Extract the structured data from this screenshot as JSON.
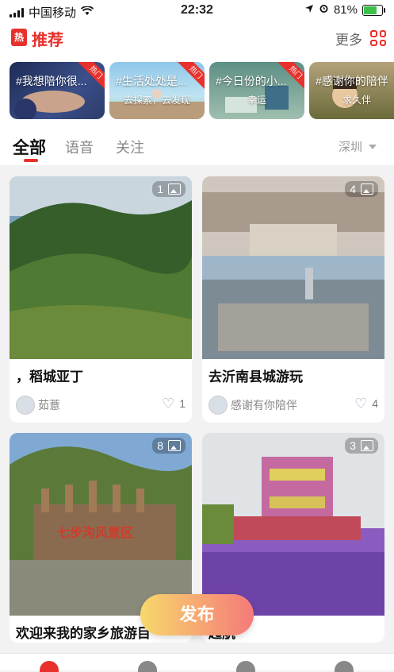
{
  "status_bar": {
    "carrier": "中国移动",
    "time": "22:32",
    "battery": "81%",
    "battery_level": 0.81
  },
  "header": {
    "hot_badge": "热",
    "title": "推荐",
    "more_label": "更多"
  },
  "topics": [
    {
      "label": "#我想陪你很...",
      "sub": "",
      "badge": "热门"
    },
    {
      "label": "#生活处处是...",
      "sub": "去探索，去发现",
      "badge": "热门"
    },
    {
      "label": "#今日份的小...",
      "sub": "幸运",
      "badge": "热门"
    },
    {
      "label": "#感谢你的陪伴",
      "sub": "求久伴",
      "badge": ""
    }
  ],
  "tabs": [
    {
      "label": "全部",
      "active": true
    },
    {
      "label": "语音",
      "active": false
    },
    {
      "label": "关注",
      "active": false
    }
  ],
  "city": "深圳",
  "posts": [
    {
      "title": "，稻城亚丁",
      "author": "茹薏",
      "likes": "1",
      "photos": "1"
    },
    {
      "title": "去沂南县城游玩",
      "author": "感谢有你陪伴",
      "likes": "4",
      "photos": "4"
    },
    {
      "title": "欢迎来我的家乡旅游目",
      "author": "",
      "likes": "",
      "photos": "8",
      "sign_text": "七步沟风景区"
    },
    {
      "title": "起航",
      "author": "",
      "likes": "",
      "photos": "3"
    }
  ],
  "publish_button": "发布",
  "colors": {
    "accent": "#e8302c",
    "publish_gradient_start": "#f7d86b",
    "publish_gradient_end": "#f57a7a"
  }
}
